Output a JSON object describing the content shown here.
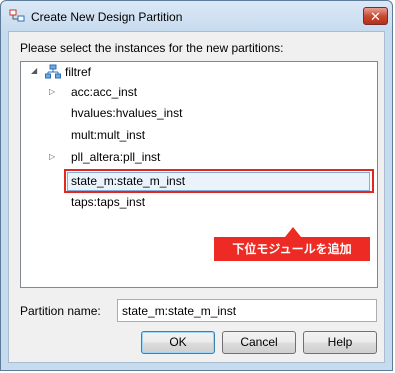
{
  "window": {
    "title": "Create New Design Partition",
    "close_label": "✕"
  },
  "prompt": "Please select the instances for the new partitions:",
  "tree": {
    "root": "filtref",
    "children": [
      {
        "label": "acc:acc_inst",
        "expandable": true
      },
      {
        "label": "hvalues:hvalues_inst",
        "expandable": false
      },
      {
        "label": "mult:mult_inst",
        "expandable": false
      },
      {
        "label": "pll_altera:pll_inst",
        "expandable": true
      },
      {
        "label": "state_m:state_m_inst",
        "expandable": false,
        "selected": true
      },
      {
        "label": "taps:taps_inst",
        "expandable": false
      }
    ]
  },
  "annotation": {
    "text": "下位モジュールを追加",
    "color": "#ee2a24"
  },
  "partition_name": {
    "label": "Partition name:",
    "value": "state_m:state_m_inst"
  },
  "buttons": {
    "ok": "OK",
    "cancel": "Cancel",
    "help": "Help"
  }
}
